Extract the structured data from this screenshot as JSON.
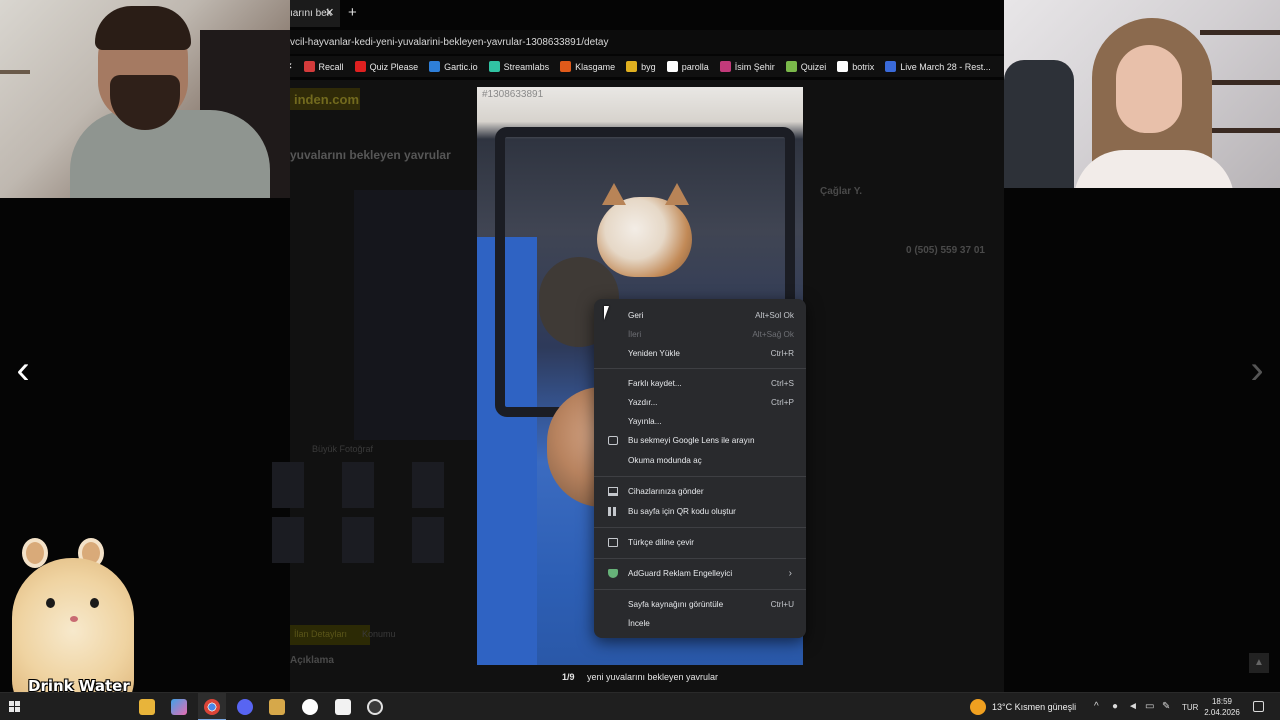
{
  "browser": {
    "tab_title": "ıarını bek",
    "tab_close": "✕",
    "new_tab": "+",
    "address": "vcil-hayvanlar-kedi-yeni-yuvalarini-bekleyen-yavrular-1308633891/detay",
    "bookmarks": [
      {
        "label": "Recall",
        "icon": "recall-icon",
        "color": "#d43b3b"
      },
      {
        "label": "Quiz Please",
        "icon": "youtube-icon",
        "color": "#e02020"
      },
      {
        "label": "Gartic.io",
        "icon": "gartic-icon",
        "color": "#2e7fd9"
      },
      {
        "label": "Streamlabs",
        "icon": "streamlabs-icon",
        "color": "#31c3a2"
      },
      {
        "label": "Klasgame",
        "icon": "klasgame-icon",
        "color": "#e05a1a"
      },
      {
        "label": "byg",
        "icon": "byg-icon",
        "color": "#e0b020"
      },
      {
        "label": "parolla",
        "icon": "parolla-icon",
        "color": "#ffffff"
      },
      {
        "label": "İsim Şehir",
        "icon": "isimsehir-icon",
        "color": "#c23a7a"
      },
      {
        "label": "Quizei",
        "icon": "quizei-icon",
        "color": "#7ab84a"
      },
      {
        "label": "botrix",
        "icon": "botrix-icon",
        "color": "#ffffff"
      },
      {
        "label": "Live March 28 - Rest...",
        "icon": "live-icon",
        "color": "#3a6ad9"
      }
    ]
  },
  "background_page": {
    "logo": "inden.com",
    "title": "yuvalarını bekleyen yavrular",
    "seller_name": "Çağlar Y.",
    "phone": "0 (505) 559 37 01",
    "big_photo": "Büyük Fotoğraf",
    "tab_ilan": "İlan Detayları",
    "tab_konum": "Konumu",
    "description": "Açıklama"
  },
  "lightbox": {
    "image_id": "#1308633891",
    "counter": "1/9",
    "caption": "yeni yuvalarını bekleyen yavrular",
    "prev_arrow": "‹",
    "next_arrow": "›",
    "scroll_top": "▲"
  },
  "context_menu": {
    "back": {
      "label": "Geri",
      "shortcut": "Alt+Sol Ok"
    },
    "forward": {
      "label": "İleri",
      "shortcut": "Alt+Sağ Ok"
    },
    "reload": {
      "label": "Yeniden Yükle",
      "shortcut": "Ctrl+R"
    },
    "save_as": {
      "label": "Farklı kaydet...",
      "shortcut": "Ctrl+S"
    },
    "print": {
      "label": "Yazdır...",
      "shortcut": "Ctrl+P"
    },
    "cast": {
      "label": "Yayınla..."
    },
    "lens": {
      "label": "Bu sekmeyi Google Lens ile arayın"
    },
    "reading": {
      "label": "Okuma modunda aç"
    },
    "send_device": {
      "label": "Cihazlarınıza gönder"
    },
    "qr": {
      "label": "Bu sayfa için QR kodu oluştur"
    },
    "translate": {
      "label": "Türkçe diline çevir"
    },
    "adguard": {
      "label": "AdGuard Reklam Engelleyici",
      "arrow": "›"
    },
    "view_source": {
      "label": "Sayfa kaynağını görüntüle",
      "shortcut": "Ctrl+U"
    },
    "inspect": {
      "label": "İncele"
    }
  },
  "overlay": {
    "drink_water": "Drink Water"
  },
  "taskbar": {
    "weather": "13°C  Kısmen güneşli",
    "language": "TUR",
    "time": "18:59",
    "date": "2.04.2026"
  }
}
